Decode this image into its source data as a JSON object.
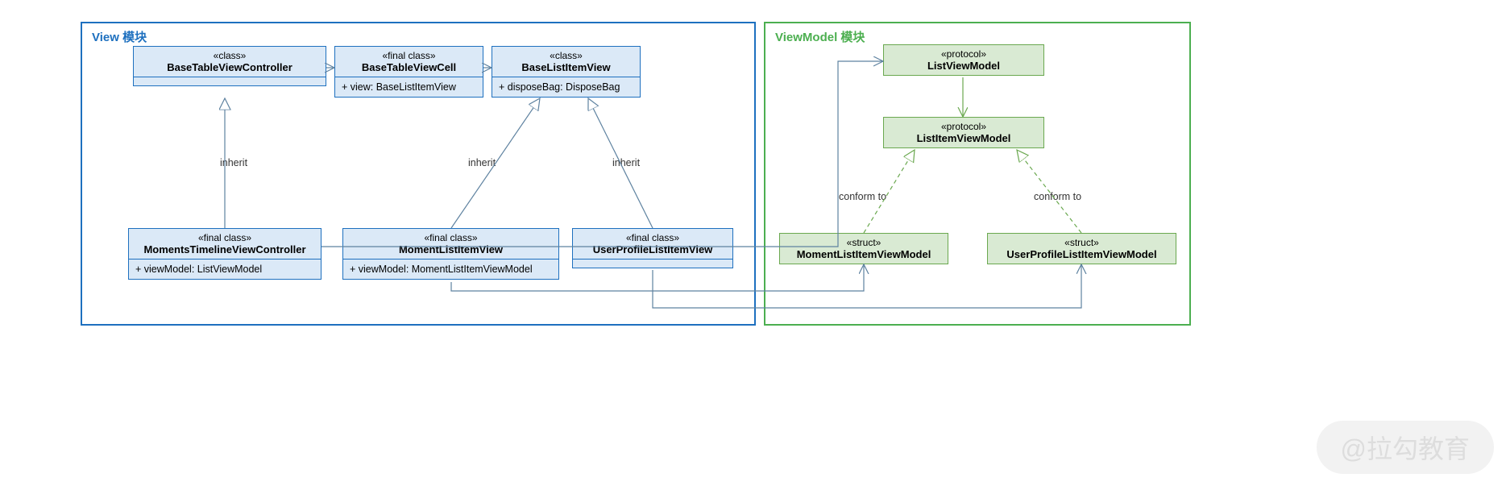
{
  "modules": {
    "view": {
      "title": "View 模块"
    },
    "viewModel": {
      "title": "ViewModel 模块"
    }
  },
  "classes": {
    "baseTableVC": {
      "stereo": "«class»",
      "name": "BaseTableViewController"
    },
    "baseTableCell": {
      "stereo": "«final class»",
      "name": "BaseTableViewCell",
      "attr1": "+ view: BaseListItemView"
    },
    "baseListItemView": {
      "stereo": "«class»",
      "name": "BaseListItemView",
      "attr1": "+ disposeBag: DisposeBag"
    },
    "momentsTimelineVC": {
      "stereo": "«final class»",
      "name": "MomentsTimelineViewController",
      "attr1": "+ viewModel: ListViewModel"
    },
    "momentListItemView": {
      "stereo": "«final class»",
      "name": "MomentListItemView",
      "attr1": "+ viewModel: MomentListItemViewModel"
    },
    "userProfileListItemView": {
      "stereo": "«final class»",
      "name": "UserProfileListItemView"
    },
    "listViewModel": {
      "stereo": "«protocol»",
      "name": "ListViewModel"
    },
    "listItemViewModel": {
      "stereo": "«protocol»",
      "name": "ListItemViewModel"
    },
    "momentListItemVM": {
      "stereo": "«struct»",
      "name": "MomentListItemViewModel"
    },
    "userProfileListItemVM": {
      "stereo": "«struct»",
      "name": "UserProfileListItemViewModel"
    }
  },
  "labels": {
    "inherit1": "inherit",
    "inherit2": "inherit",
    "inherit3": "inherit",
    "conform1": "conform to",
    "conform2": "conform to"
  },
  "watermark": "@拉勾教育"
}
